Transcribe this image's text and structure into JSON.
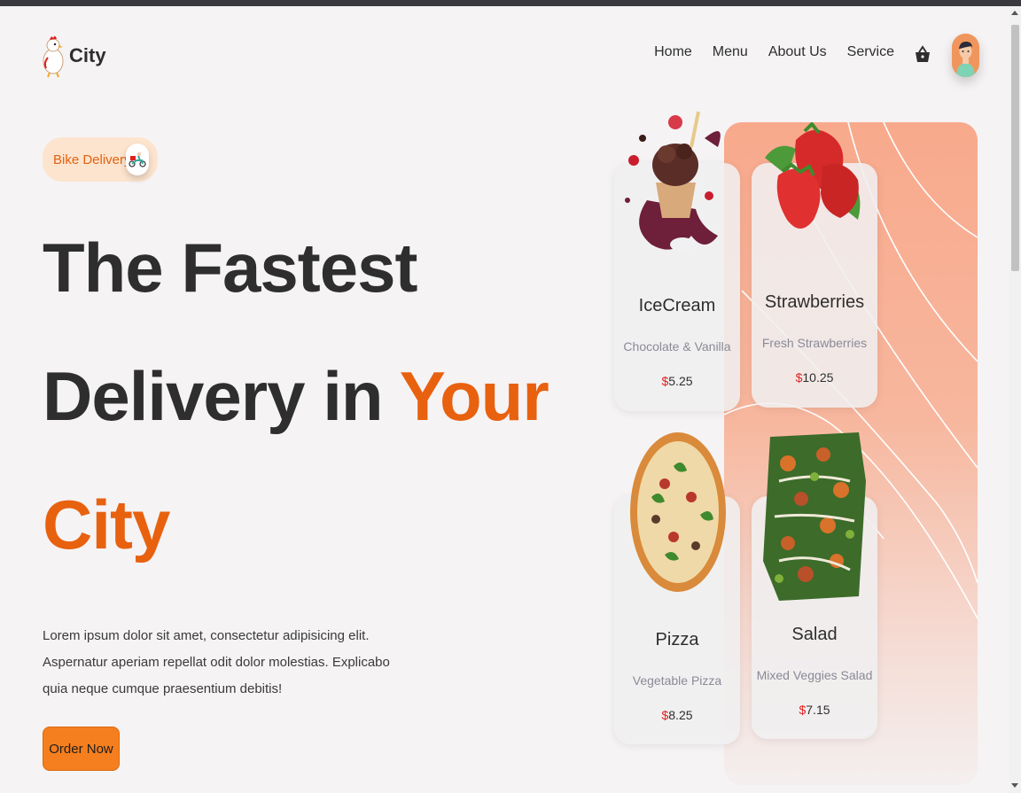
{
  "brand": {
    "name": "City"
  },
  "nav": {
    "items": [
      "Home",
      "Menu",
      "About Us",
      "Service"
    ]
  },
  "hero": {
    "badge": "Bike Delivery",
    "title_line1": "The Fastest",
    "title_line2_a": "Delivery in ",
    "title_line2_b": "Your",
    "title_line3": "City",
    "description": "Lorem ipsum dolor sit amet, consectetur adipisicing elit. Aspernatur aperiam repellat odit dolor molestias. Explicabo quia neque cumque praesentium debitis!",
    "cta": "Order Now"
  },
  "cards": [
    {
      "name": "IceCream",
      "subtitle": "Chocolate & Vanilla",
      "currency": "$",
      "price": "5.25"
    },
    {
      "name": "Strawberries",
      "subtitle": "Fresh Strawberries",
      "currency": "$",
      "price": "10.25"
    },
    {
      "name": "Pizza",
      "subtitle": "Vegetable Pizza",
      "currency": "$",
      "price": "8.25"
    },
    {
      "name": "Salad",
      "subtitle": "Mixed Veggies Salad",
      "currency": "$",
      "price": "7.15"
    }
  ],
  "colors": {
    "accent": "#e8610f",
    "button": "#f57f1e",
    "panel": "#f8a98c",
    "badge_bg": "#fde4cf",
    "price_symbol": "#e0201e"
  },
  "icons": {
    "cart": "basket-icon",
    "avatar": "user-avatar",
    "bike": "scooter-icon",
    "logo": "chicken-logo"
  }
}
